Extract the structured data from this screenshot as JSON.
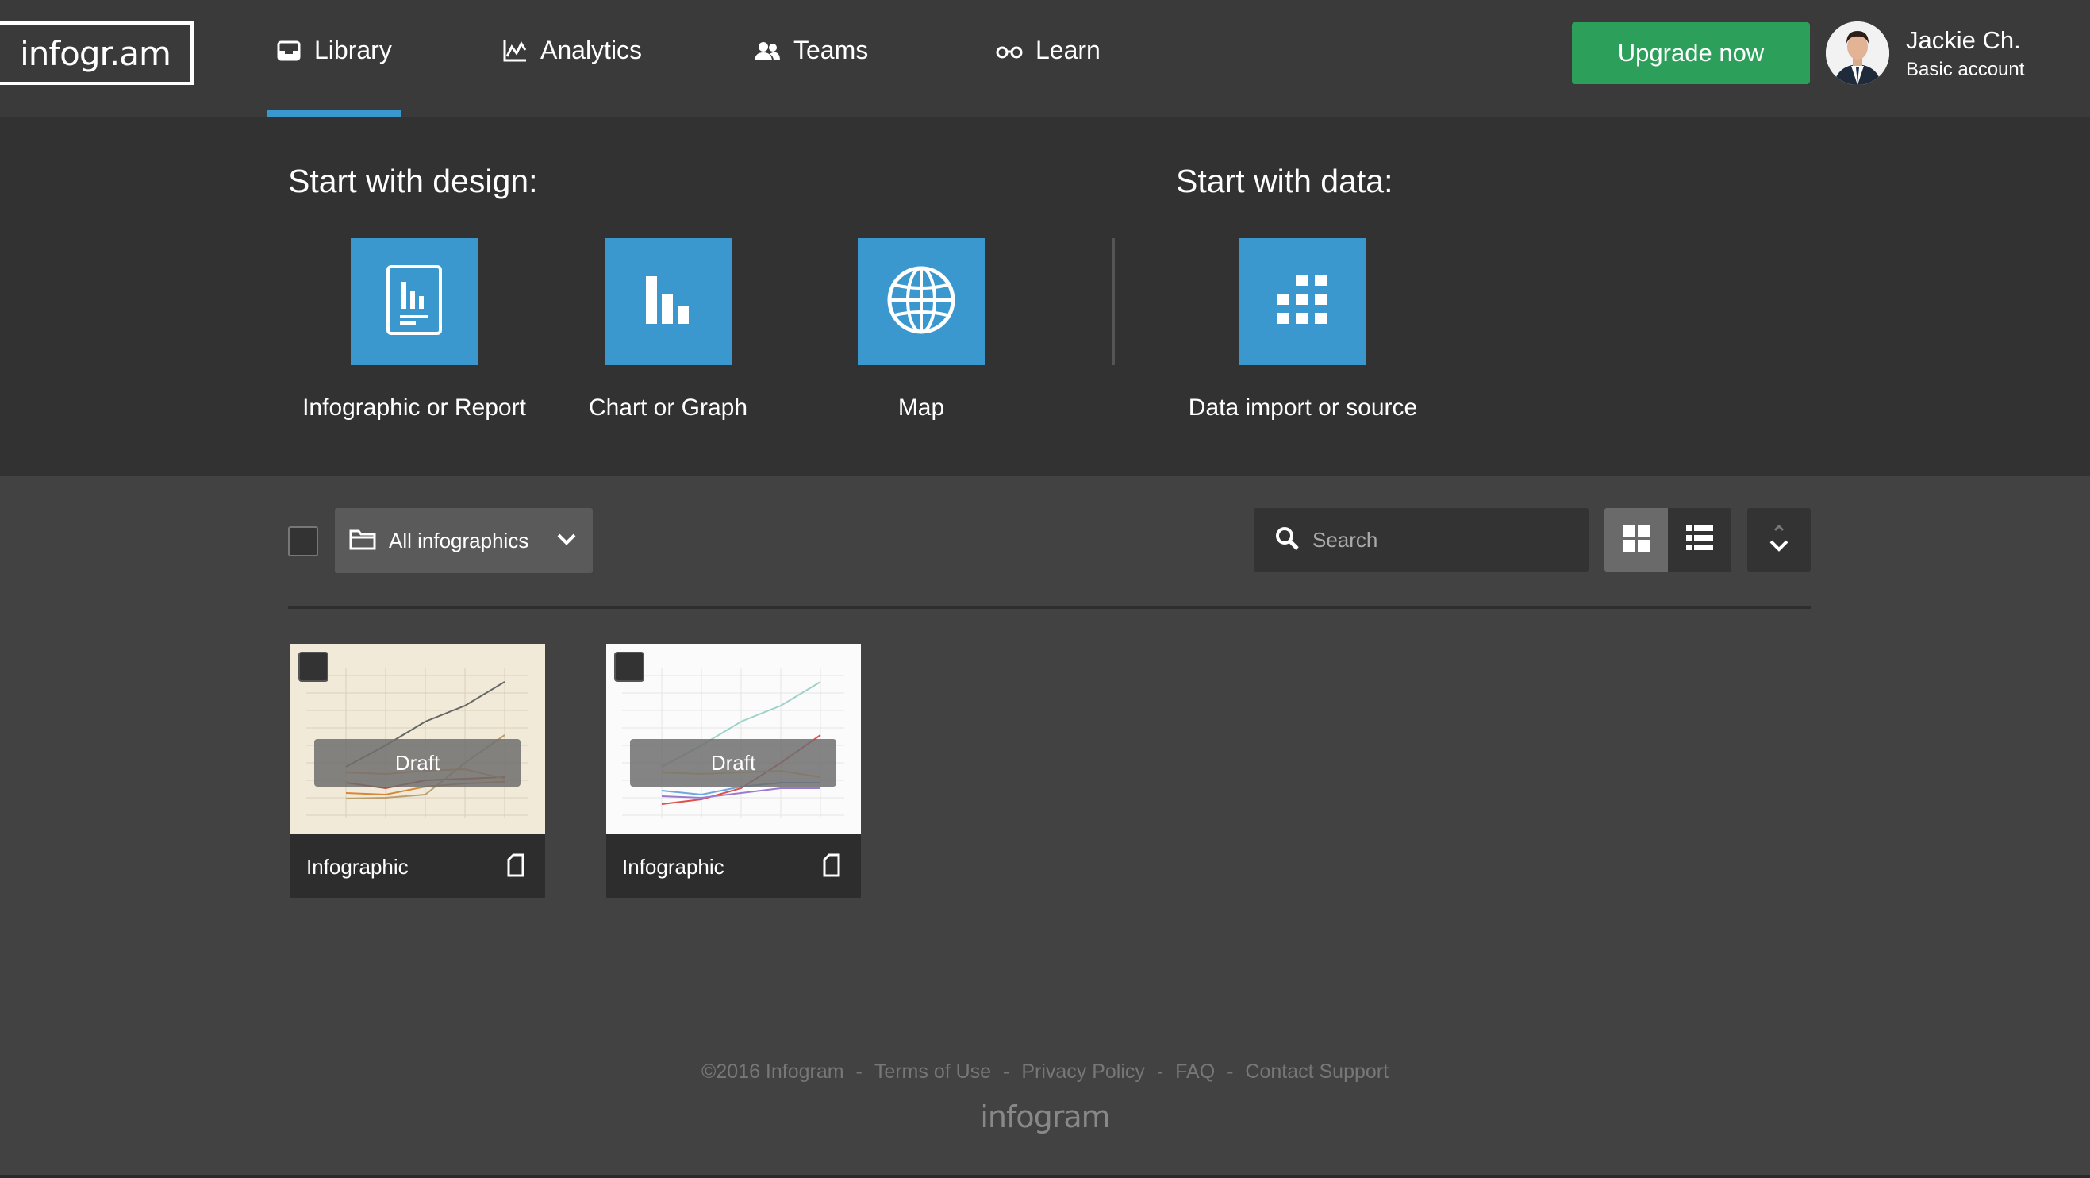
{
  "brand": {
    "logo_text": "infogr.am"
  },
  "nav": {
    "items": [
      {
        "label": "Library",
        "icon": "inbox-icon",
        "active": true
      },
      {
        "label": "Analytics",
        "icon": "line-chart-icon",
        "active": false
      },
      {
        "label": "Teams",
        "icon": "people-icon",
        "active": false
      },
      {
        "label": "Learn",
        "icon": "glasses-icon",
        "active": false
      }
    ],
    "accent_color": "#3a98cf"
  },
  "header": {
    "upgrade_label": "Upgrade now",
    "upgrade_color": "#2ca05a",
    "user_name": "Jackie Ch.",
    "user_plan": "Basic account"
  },
  "create": {
    "design_title": "Start with design:",
    "data_title": "Start with data:",
    "tiles": [
      {
        "label": "Infographic or Report",
        "icon": "report-icon"
      },
      {
        "label": "Chart or Graph",
        "icon": "bar-chart-icon"
      },
      {
        "label": "Map",
        "icon": "globe-icon"
      },
      {
        "label": "Data import or source",
        "icon": "grid-icon"
      }
    ],
    "tile_color": "#3a98cf"
  },
  "library": {
    "folder_label": "All infographics",
    "search_placeholder": "Search",
    "view_mode": "grid",
    "cards": [
      {
        "status": "Draft",
        "type": "Infographic",
        "theme": "beige"
      },
      {
        "status": "Draft",
        "type": "Infographic",
        "theme": "white"
      }
    ]
  },
  "footer": {
    "copyright": "©2016 Infogram",
    "sep": "-",
    "links": [
      "Terms of Use",
      "Privacy Policy",
      "FAQ",
      "Contact Support"
    ],
    "logo_text": "infogram"
  }
}
